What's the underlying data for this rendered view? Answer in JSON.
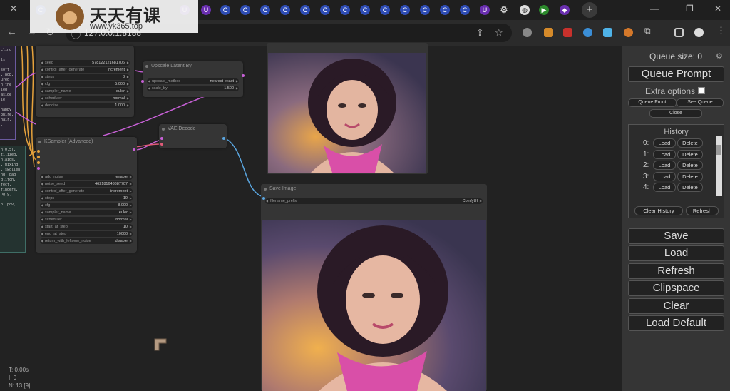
{
  "browser": {
    "tabs_icons": [
      "comfyui-tab-icon",
      "github-tab-icon",
      "comfyui-tab-icon",
      "comfyui-tab-icon",
      "comfyui-tab-icon"
    ],
    "address": "127.0.0.1:8188",
    "new_tab_label": "+",
    "win_minimize": "—",
    "win_restore": "❐",
    "win_close": "✕"
  },
  "watermark": {
    "title": "天天有课",
    "url": "www.yk365.top"
  },
  "nodes": {
    "ksampler_top": {
      "widgets": [
        {
          "label": "seed",
          "value": "578122121681706"
        },
        {
          "label": "control_after_generate",
          "value": "increment"
        },
        {
          "label": "steps",
          "value": "8"
        },
        {
          "label": "cfg",
          "value": "5.000"
        },
        {
          "label": "sampler_name",
          "value": "euler"
        },
        {
          "label": "scheduler",
          "value": "normal"
        },
        {
          "label": "denoise",
          "value": "1.000"
        }
      ]
    },
    "upscale": {
      "title": "Upscale Latent By",
      "widgets": [
        {
          "label": "upscale_method",
          "value": "nearest-exact"
        },
        {
          "label": "scale_by",
          "value": "1.500"
        }
      ]
    },
    "ksampler_adv": {
      "title": "KSampler (Advanced)",
      "widgets": [
        {
          "label": "add_noise",
          "value": "enable"
        },
        {
          "label": "noise_seed",
          "value": "462181648887707"
        },
        {
          "label": "control_after_generate",
          "value": "increment"
        },
        {
          "label": "steps",
          "value": "10"
        },
        {
          "label": "cfg",
          "value": "8.000"
        },
        {
          "label": "sampler_name",
          "value": "euler"
        },
        {
          "label": "scheduler",
          "value": "normal"
        },
        {
          "label": "start_at_step",
          "value": "10"
        },
        {
          "label": "end_at_step",
          "value": "10000"
        },
        {
          "label": "return_with_leftover_noise",
          "value": "disable"
        }
      ]
    },
    "vae_decode": {
      "title": "VAE Decode"
    },
    "save_image": {
      "title": "Save Image",
      "filename_label": "filename_prefix",
      "filename_value": "ComfyUI"
    },
    "prompt_text_1": "cling\n\nls\n\nsoft\n, 8dp,\nured\nn the\nled\naside\nle\n\nhappy\nphire,\nhair,\n.",
    "prompt_text_2": "n:0.5),\ntilized,\nnlaids,\n, mixing\n, swollen,\nnd, bad\nglitch,\nfect,\nfingers,\nugly,\n\np, pov,"
  },
  "stats": {
    "time": "T: 0.00s",
    "items": "I: 0",
    "nodes": "N: 13 [9]"
  },
  "menu": {
    "queue_size": "Queue size: 0",
    "queue_prompt": "Queue Prompt",
    "extra_options": "Extra options",
    "queue_front": "Queue Front",
    "see_queue": "See Queue",
    "close": "Close",
    "history_title": "History",
    "history": [
      {
        "index": "0:",
        "load": "Load",
        "delete": "Delete"
      },
      {
        "index": "1:",
        "load": "Load",
        "delete": "Delete"
      },
      {
        "index": "2:",
        "load": "Load",
        "delete": "Delete"
      },
      {
        "index": "3:",
        "load": "Load",
        "delete": "Delete"
      },
      {
        "index": "4:",
        "load": "Load",
        "delete": "Delete"
      }
    ],
    "clear_history": "Clear History",
    "refresh_small": "Refresh",
    "save": "Save",
    "load": "Load",
    "refresh": "Refresh",
    "clipspace": "Clipspace",
    "clear": "Clear",
    "load_default": "Load Default"
  }
}
